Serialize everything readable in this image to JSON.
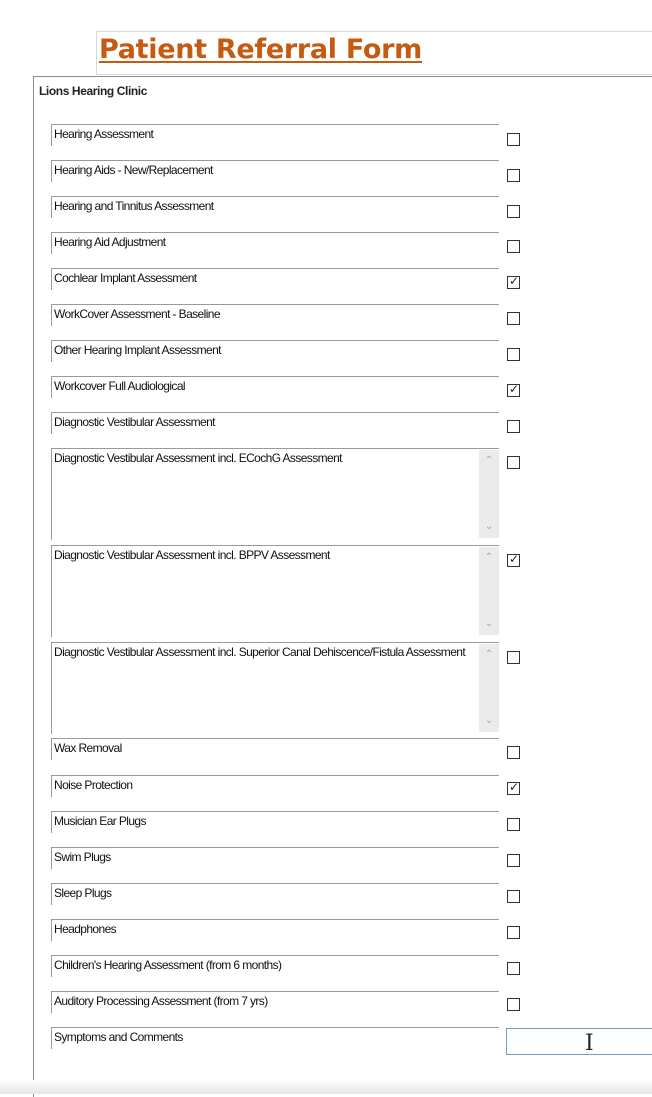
{
  "form": {
    "title": "Patient Referral Form",
    "clinic": "Lions Hearing Clinic"
  },
  "items": [
    {
      "label": "Hearing Assessment",
      "checked": false
    },
    {
      "label": "Hearing Aids - New/Replacement",
      "checked": false
    },
    {
      "label": "Hearing and Tinnitus Assessment",
      "checked": false
    },
    {
      "label": "Hearing Aid Adjustment",
      "checked": false
    },
    {
      "label": "Cochlear Implant Assessment",
      "checked": true
    },
    {
      "label": "WorkCover Assessment - Baseline",
      "checked": false
    },
    {
      "label": "Other Hearing Implant Assessment",
      "checked": false
    },
    {
      "label": "Workcover Full Audiological",
      "checked": true
    },
    {
      "label": "Diagnostic Vestibular Assessment",
      "checked": false
    },
    {
      "label": "Diagnostic Vestibular Assessment incl. ECochG Assessment",
      "checked": false
    },
    {
      "label": "Diagnostic Vestibular Assessment incl. BPPV Assessment",
      "checked": true
    },
    {
      "label": "Diagnostic Vestibular Assessment incl. Superior Canal Dehiscence/Fistula Assessment",
      "checked": false
    },
    {
      "label": "Wax Removal",
      "checked": false
    },
    {
      "label": "Noise Protection",
      "checked": true
    },
    {
      "label": "Musician Ear Plugs",
      "checked": false
    },
    {
      "label": "Swim Plugs",
      "checked": false
    },
    {
      "label": "Sleep Plugs",
      "checked": false
    },
    {
      "label": "Headphones",
      "checked": false
    },
    {
      "label": "Children's Hearing Assessment (from 6 months)",
      "checked": false
    },
    {
      "label": "Auditory Processing Assessment (from 7 yrs)",
      "checked": false
    }
  ],
  "comments": {
    "label": "Symptoms and Comments",
    "value": ""
  },
  "colors": {
    "title": "#c55a11",
    "border": "#9a9a9a"
  }
}
